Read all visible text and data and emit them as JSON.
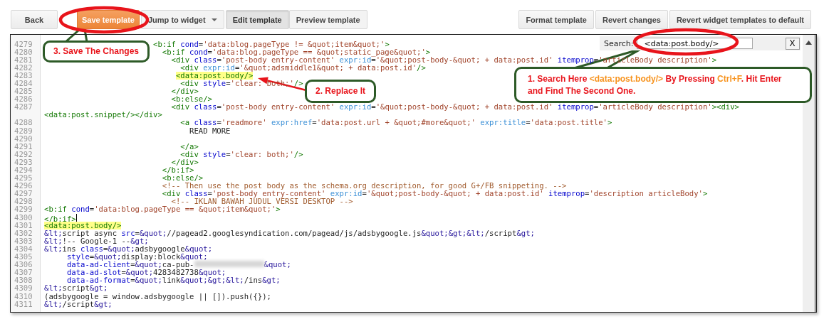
{
  "toolbar": {
    "left": [
      {
        "label": "Back",
        "kind": "plain"
      },
      {
        "label": "Save template",
        "kind": "primary"
      },
      {
        "label": "Jump to widget",
        "kind": "dropdown"
      },
      {
        "label": "Edit template",
        "kind": "toggle",
        "selected": true
      },
      {
        "label": "Preview template",
        "kind": "toggle",
        "selected": false
      }
    ],
    "right": [
      {
        "label": "Format template",
        "kind": "plain"
      },
      {
        "label": "Revert changes",
        "kind": "plain"
      },
      {
        "label": "Revert widget templates to default",
        "kind": "plain"
      }
    ]
  },
  "search": {
    "label": "Search:",
    "value": "<data:post.body/>",
    "close": "X"
  },
  "editor": {
    "lines": [
      {
        "number": "4279",
        "text": "                        <b:if cond='data:blog.pageType != &quot;item&quot;'>"
      },
      {
        "number": "4280",
        "text": "                          <b:if cond='data:blog.pageType == &quot;static_page&quot;'>"
      },
      {
        "number": "4281",
        "text": "                            <div class='post-body entry-content' expr:id='&quot;post-body-&quot; + data:post.id' itemprop='articleBody description'>"
      },
      {
        "number": "4282",
        "text": "                              <div expr:id='&quot;adsmiddle1&quot; + data:post.id'/>"
      },
      {
        "number": "4283",
        "text": "                             <data:post.body/>",
        "highlighted": true
      },
      {
        "number": "4284",
        "text": "                              <div style='clear: both;'/>"
      },
      {
        "number": "4285",
        "text": "                            </div>"
      },
      {
        "number": "4286",
        "text": "                            <b:else/>"
      },
      {
        "number": "4287",
        "text": "                            <div class='post-body entry-content' expr:id='&quot;post-body-&quot; + data:post.id' itemprop='articleBody description'><div>",
        "wrap": "<data:post.snippet/></div>"
      },
      {
        "number": "4288",
        "text": "                              <a class='readmore' expr:href='data:post.url + &quot;#more&quot;' expr:title='data:post.title'>"
      },
      {
        "number": "4289",
        "text": "                                READ MORE"
      },
      {
        "number": "4290"
      },
      {
        "number": "4291",
        "text": "                              </a>"
      },
      {
        "number": "4292",
        "text": "                              <div style='clear: both;'/>"
      },
      {
        "number": "4293",
        "text": "                            </div>"
      },
      {
        "number": "4294",
        "text": "                          </b:if>"
      },
      {
        "number": "4295",
        "text": "                          <b:else/>"
      },
      {
        "number": "4296",
        "text": "                          <!-- Then use the post body as the schema.org description, for good G+/FB snippeting. -->"
      },
      {
        "number": "4297",
        "text": "                          <div class='post-body entry-content' expr:id='&quot;post-body-&quot; + data:post.id' itemprop='description articleBody'>"
      },
      {
        "number": "4298",
        "text": "                            <!-- IKLAN BAWAH JUDUL VERSI DESKTOP -->"
      },
      {
        "number": "4299",
        "text": "<b:if cond='data:blog.pageType == &quot;item&quot;'>"
      },
      {
        "number": "4300",
        "text": "</b:if>",
        "cursor": true
      },
      {
        "number": "4301",
        "text": "<data:post.body/>",
        "highlighted": true
      },
      {
        "number": "4302",
        "text": "&lt;script async src=&quot;//pagead2.googlesyndication.com/pagead/js/adsbygoogle.js&quot;&gt;&lt;/script&gt;"
      },
      {
        "number": "4303",
        "text": "&lt;!-- Google-1 --&gt;"
      },
      {
        "number": "4304",
        "text": "&lt;ins class=&quot;adsbygoogle&quot;"
      },
      {
        "number": "4305",
        "text": "     style=&quot;display:block&quot;"
      },
      {
        "number": "4306",
        "text": "     data-ad-client=&quot;ca-pub-",
        "redacted": true,
        "after": "&quot;"
      },
      {
        "number": "4307",
        "text": "     data-ad-slot=&quot;4283482738&quot;"
      },
      {
        "number": "4308",
        "text": "     data-ad-format=&quot;link&quot;&gt;&lt;/ins&gt;"
      },
      {
        "number": "4309",
        "text": "&lt;script&gt;"
      },
      {
        "number": "4310",
        "text": "(adsbygoogle = window.adsbygoogle || []).push({});"
      },
      {
        "number": "4311",
        "text": "&lt;/script&gt;"
      }
    ]
  },
  "annotations": [
    {
      "kind": "ellipse"
    },
    {
      "kind": "callout",
      "parts": [
        {
          "text": "3. Save The Changes",
          "accent": false
        }
      ]
    },
    {
      "kind": "arrow"
    },
    {
      "kind": "callout",
      "parts": [
        {
          "text": "2. Replace It",
          "accent": false
        }
      ]
    },
    {
      "kind": "ellipse"
    },
    {
      "kind": "callout",
      "parts": [
        {
          "text": "1. Search Here ",
          "accent": false
        },
        {
          "text": "<data:post.body/>",
          "accent": true
        },
        {
          "text": " By Pressing ",
          "accent": false
        },
        {
          "text": "Ctrl+F",
          "accent": true
        },
        {
          "text": ". Hit Enter and Find The Second One.",
          "accent": false
        }
      ]
    }
  ]
}
